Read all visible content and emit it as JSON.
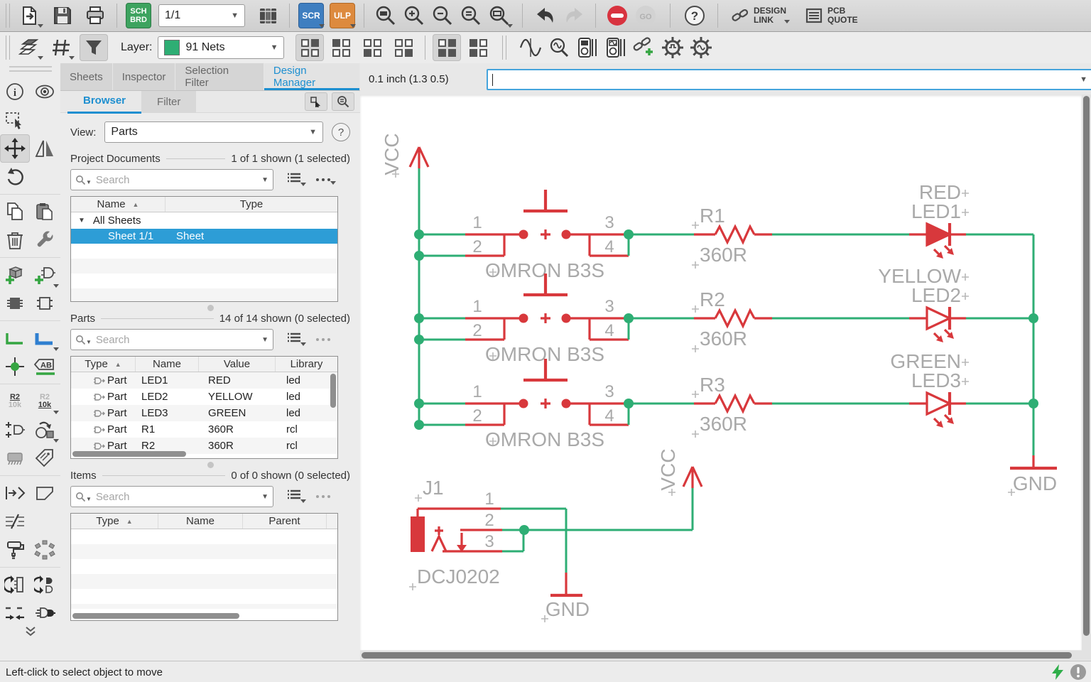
{
  "toolbar_main": {
    "page_indicator": "1/1",
    "sch_label": "SCH",
    "brd_label": "BRD",
    "scr_label": "SCR",
    "ulp_label": "ULP",
    "go_label": "GO",
    "help_label": "?",
    "design_link_line1": "DESIGN",
    "design_link_line2": "LINK",
    "pcb_quote_line1": "PCB",
    "pcb_quote_line2": "QUOTE"
  },
  "toolbar_layer": {
    "layer_label": "Layer:",
    "layer_value": "91 Nets",
    "layer_color": "#2eae74"
  },
  "left_toolbar": {
    "name_tool_top": "R2",
    "name_tool_bottom": "10k",
    "value_tool_top": "R2",
    "value_tool_bottom": "10k",
    "label_tool": "AB"
  },
  "panel": {
    "tabs": [
      {
        "label": "Sheets"
      },
      {
        "label": "Inspector"
      },
      {
        "label": "Selection Filter"
      },
      {
        "label": "Design Manager"
      }
    ],
    "subtabs": [
      {
        "label": "Browser"
      },
      {
        "label": "Filter"
      }
    ],
    "view_label": "View:",
    "view_value": "Parts",
    "project_documents": {
      "title": "Project Documents",
      "count": "1 of 1 shown (1 selected)",
      "search_placeholder": "Search",
      "col_name": "Name",
      "col_type": "Type",
      "group_row": "All Sheets",
      "selected_row_name": "Sheet 1/1",
      "selected_row_type": "Sheet"
    },
    "parts": {
      "title": "Parts",
      "count": "14 of 14 shown (0 selected)",
      "search_placeholder": "Search",
      "col_type": "Type",
      "col_name": "Name",
      "col_value": "Value",
      "col_library": "Library",
      "rows": [
        {
          "type": "Part",
          "name": "LED1",
          "value": "RED",
          "library": "led"
        },
        {
          "type": "Part",
          "name": "LED2",
          "value": "YELLOW",
          "library": "led"
        },
        {
          "type": "Part",
          "name": "LED3",
          "value": "GREEN",
          "library": "led"
        },
        {
          "type": "Part",
          "name": "R1",
          "value": "360R",
          "library": "rcl"
        },
        {
          "type": "Part",
          "name": "R2",
          "value": "360R",
          "library": "rcl"
        }
      ]
    },
    "items": {
      "title": "Items",
      "count": "0 of 0 shown (0 selected)",
      "search_placeholder": "Search",
      "col_type": "Type",
      "col_name": "Name",
      "col_parent": "Parent",
      "rows": []
    }
  },
  "canvas": {
    "coordinates": "0.1 inch (1.3 0.5)",
    "command_value": "",
    "schematic": {
      "colors": {
        "net": "#2eae74",
        "symbol": "#d8383c",
        "label": "#a9a9a9"
      },
      "vcc_label": "VCC",
      "gnd_label": "GND",
      "switches": [
        {
          "name": "OMRON B3S",
          "pins": [
            "1",
            "2",
            "3",
            "4"
          ]
        },
        {
          "name": "OMRON B3S",
          "pins": [
            "1",
            "2",
            "3",
            "4"
          ]
        },
        {
          "name": "OMRON B3S",
          "pins": [
            "1",
            "2",
            "3",
            "4"
          ]
        }
      ],
      "resistors": [
        {
          "name": "R1",
          "value": "360R"
        },
        {
          "name": "R2",
          "value": "360R"
        },
        {
          "name": "R3",
          "value": "360R"
        }
      ],
      "leds": [
        {
          "name": "LED1",
          "value": "RED"
        },
        {
          "name": "LED2",
          "value": "YELLOW"
        },
        {
          "name": "LED3",
          "value": "GREEN"
        }
      ],
      "connector": {
        "name": "J1",
        "value": "DCJ0202",
        "pins": [
          "1",
          "2",
          "3"
        ]
      }
    }
  },
  "status_bar": {
    "message": "Left-click to select object to move"
  }
}
